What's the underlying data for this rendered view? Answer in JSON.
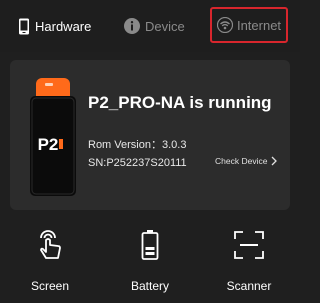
{
  "tabs": {
    "hardware": "Hardware",
    "device": "Device",
    "internet": "Internet"
  },
  "device": {
    "status": "P2_PRO-NA is running",
    "rom_version": "Rom Version：3.0.3",
    "serial": "SN:P252237S20111",
    "check_label": "Check Device",
    "logo_text": "P2"
  },
  "tools": {
    "screen": "Screen",
    "battery": "Battery",
    "scanner": "Scanner"
  },
  "colors": {
    "background": "#1f1f1f",
    "card": "#2c2c2c",
    "highlight_border": "#d8262d",
    "accent_orange": "#ff6a1a"
  }
}
